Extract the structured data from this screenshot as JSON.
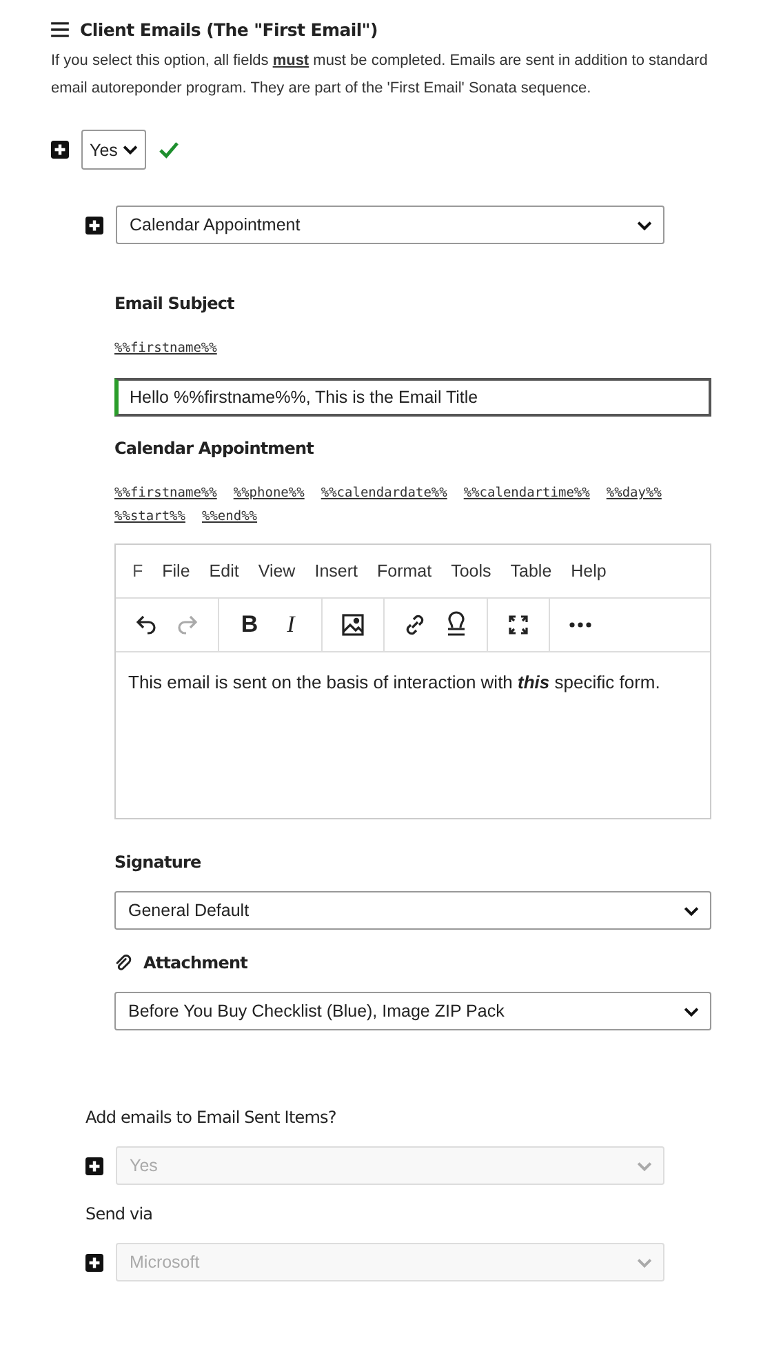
{
  "section": {
    "title": "Client Emails (The \"First Email\")",
    "description": "If you select this option, all fields **must** must be completed. Emails are sent in addition to standard email autoreponder program. They are part of the 'First Email' Sonata sequence."
  },
  "enable": {
    "value": "Yes",
    "valid": true
  },
  "email_type": {
    "value": "Calendar Appointment"
  },
  "subject": {
    "label": "Email Subject",
    "tokens": [
      "%%firstname%%"
    ],
    "value": "Hello %%firstname%%, This is the Email Title",
    "valid": true
  },
  "body": {
    "label": "Calendar Appointment",
    "tokens": [
      "%%firstname%%",
      "%%phone%%",
      "%%calendardate%%",
      "%%calendartime%%",
      "%%day%%",
      "%%start%%",
      "%%end%%"
    ],
    "editor": {
      "menus": [
        "F",
        "File",
        "Edit",
        "View",
        "Insert",
        "Format",
        "Tools",
        "Table",
        "Help"
      ],
      "toolbar": [
        [
          {
            "kind": "undo",
            "disabled": false
          },
          {
            "kind": "redo",
            "disabled": true
          }
        ],
        [
          {
            "kind": "text",
            "label": "B",
            "disabled": false
          },
          {
            "kind": "text",
            "label": "I",
            "disabled": false
          }
        ],
        [
          {
            "kind": "image",
            "disabled": false
          }
        ],
        [
          {
            "kind": "link",
            "disabled": false
          },
          {
            "kind": "stamp",
            "disabled": false
          }
        ],
        [
          {
            "kind": "fullscreen",
            "disabled": false
          }
        ],
        [
          {
            "kind": "more",
            "disabled": false
          }
        ]
      ],
      "content": "This email is sent on the basis of interaction with **this** specific form."
    }
  },
  "signature": {
    "label": "Signature",
    "value": "General Default"
  },
  "attachment": {
    "label": "Attachment",
    "value": "Before You Buy Checklist (Blue), Image ZIP Pack"
  },
  "options": [
    {
      "label": "Add emails to Email Sent Items?",
      "value": "Yes",
      "disabled": true
    },
    {
      "label": "Send via",
      "value": "Microsoft",
      "disabled": true
    }
  ]
}
